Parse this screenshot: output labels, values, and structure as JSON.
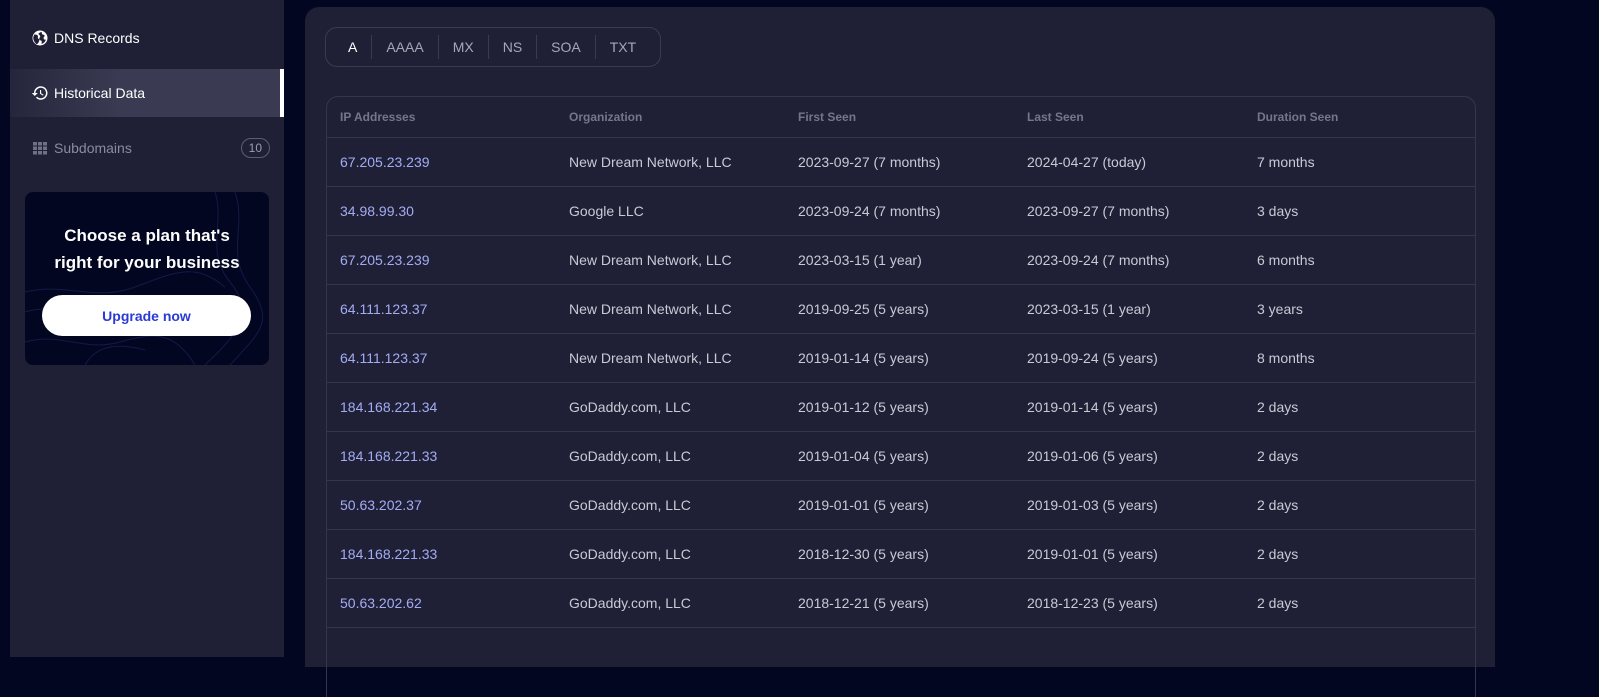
{
  "sidebar": {
    "items": [
      {
        "label": "DNS Records",
        "icon": "globe-icon"
      },
      {
        "label": "Historical Data",
        "icon": "history-icon",
        "active": true
      },
      {
        "label": "Subdomains",
        "icon": "grid-icon",
        "badge": "10"
      }
    ],
    "promo": {
      "title_line1": "Choose a plan that's",
      "title_line2": "right for your business",
      "button_label": "Upgrade now"
    }
  },
  "main": {
    "record_tabs": [
      "A",
      "AAAA",
      "MX",
      "NS",
      "SOA",
      "TXT"
    ],
    "active_tab": "A",
    "table": {
      "columns": [
        "IP Addresses",
        "Organization",
        "First Seen",
        "Last Seen",
        "Duration Seen"
      ],
      "rows": [
        [
          "67.205.23.239",
          "New Dream Network, LLC",
          "2023-09-27 (7 months)",
          "2024-04-27 (today)",
          "7 months"
        ],
        [
          "34.98.99.30",
          "Google LLC",
          "2023-09-24 (7 months)",
          "2023-09-27 (7 months)",
          "3 days"
        ],
        [
          "67.205.23.239",
          "New Dream Network, LLC",
          "2023-03-15 (1 year)",
          "2023-09-24 (7 months)",
          "6 months"
        ],
        [
          "64.111.123.37",
          "New Dream Network, LLC",
          "2019-09-25 (5 years)",
          "2023-03-15 (1 year)",
          "3 years"
        ],
        [
          "64.111.123.37",
          "New Dream Network, LLC",
          "2019-01-14 (5 years)",
          "2019-09-24 (5 years)",
          "8 months"
        ],
        [
          "184.168.221.34",
          "GoDaddy.com, LLC",
          "2019-01-12 (5 years)",
          "2019-01-14 (5 years)",
          "2 days"
        ],
        [
          "184.168.221.33",
          "GoDaddy.com, LLC",
          "2019-01-04 (5 years)",
          "2019-01-06 (5 years)",
          "2 days"
        ],
        [
          "50.63.202.37",
          "GoDaddy.com, LLC",
          "2019-01-01 (5 years)",
          "2019-01-03 (5 years)",
          "2 days"
        ],
        [
          "184.168.221.33",
          "GoDaddy.com, LLC",
          "2018-12-30 (5 years)",
          "2019-01-01 (5 years)",
          "2 days"
        ],
        [
          "50.63.202.62",
          "GoDaddy.com, LLC",
          "2018-12-21 (5 years)",
          "2018-12-23 (5 years)",
          "2 days"
        ]
      ]
    }
  },
  "colors": {
    "page_bg": "#030620",
    "panel_bg": "#1f2036",
    "ip_link": "#a3acf2",
    "upgrade_text": "#2a3ad6"
  }
}
